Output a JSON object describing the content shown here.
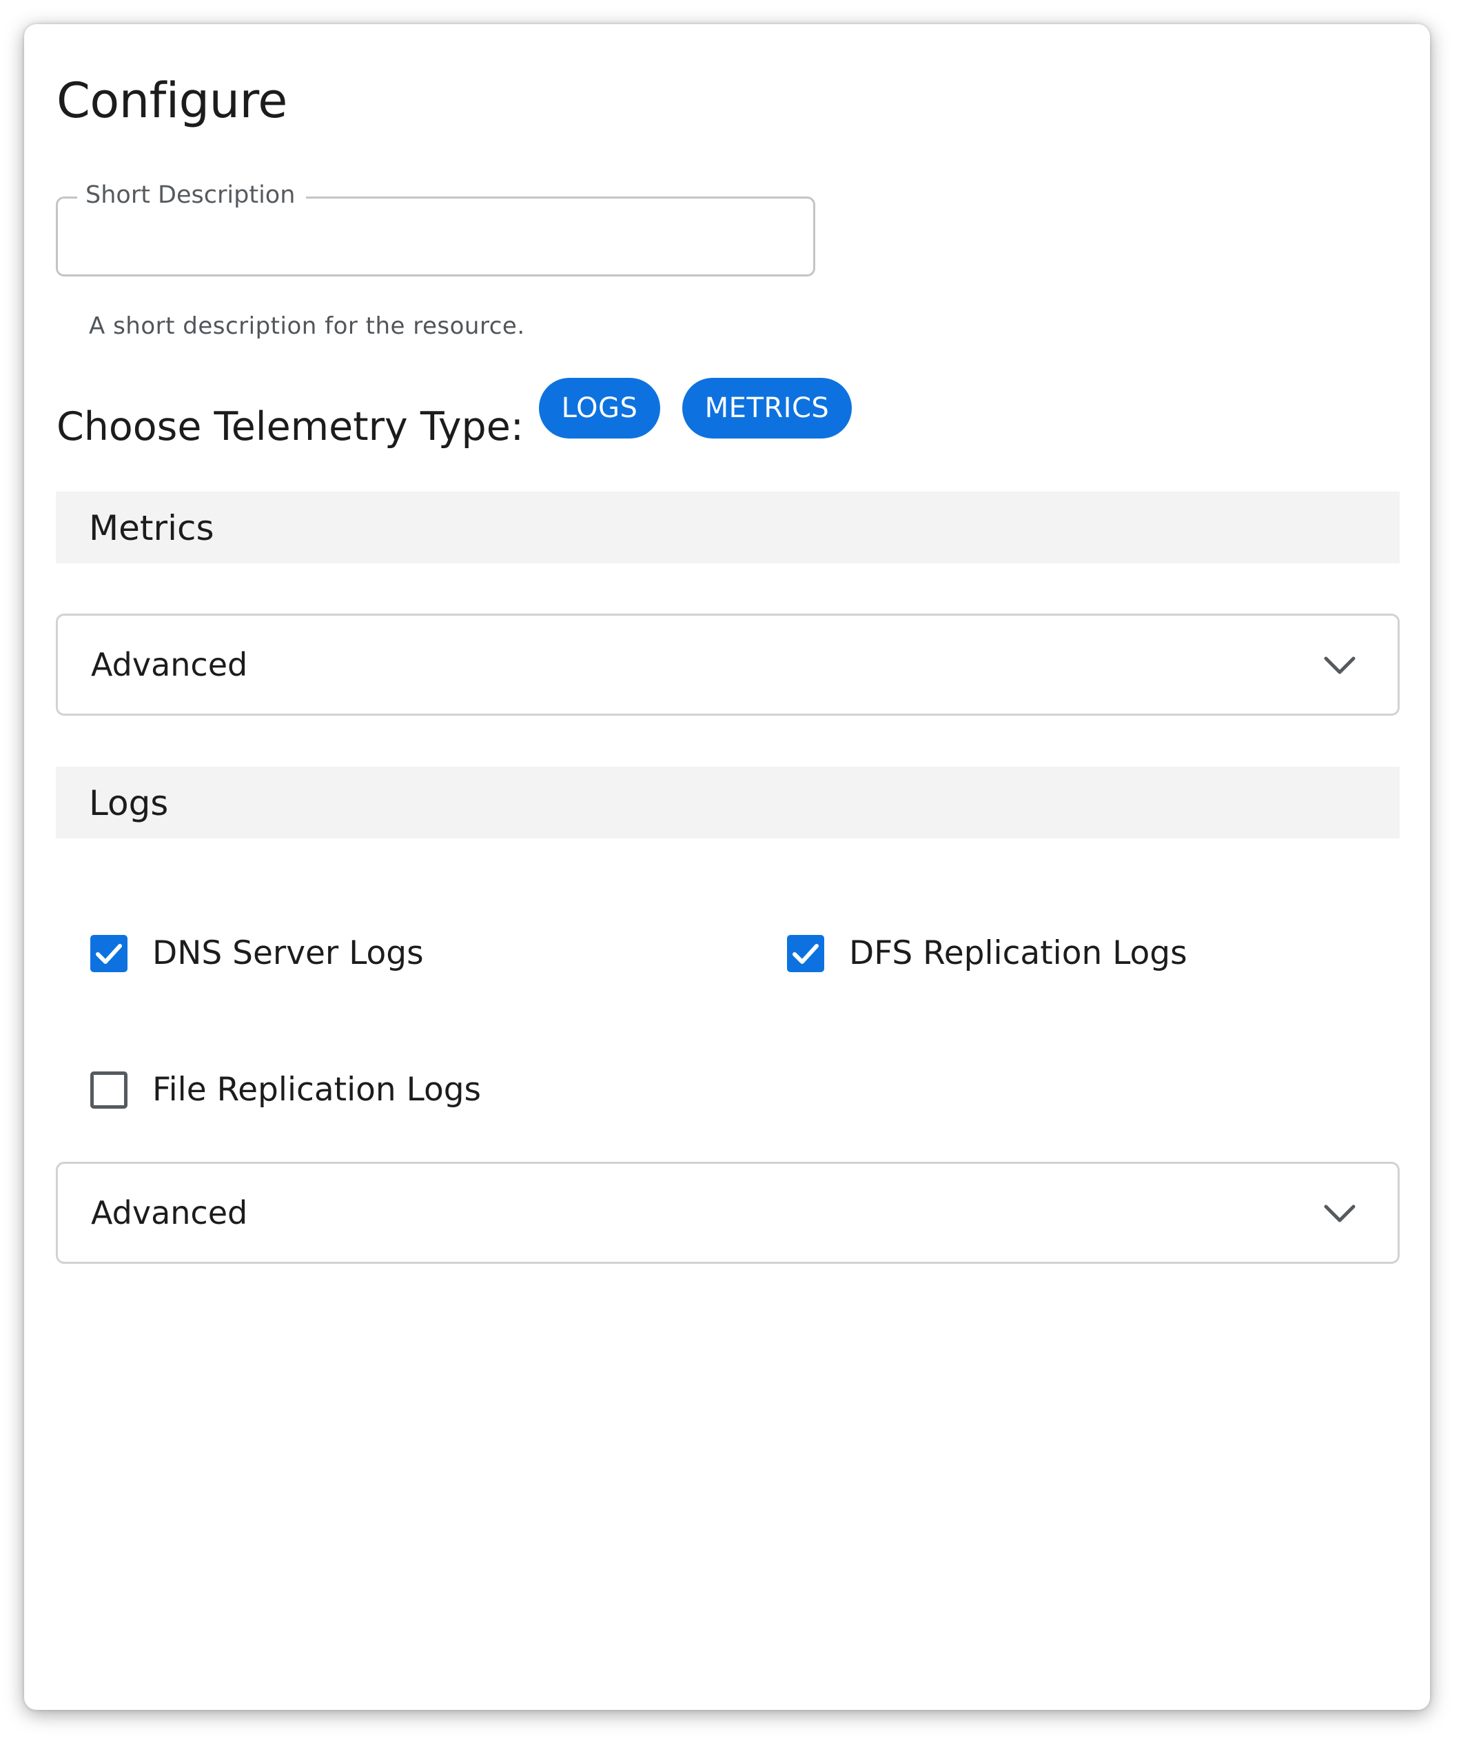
{
  "page": {
    "title": "Configure"
  },
  "short_description": {
    "label": "Short Description",
    "value": "",
    "placeholder": "",
    "helper": "A short description for the resource."
  },
  "telemetry": {
    "label": "Choose Telemetry Type:",
    "chips": [
      {
        "label": "LOGS",
        "selected": true
      },
      {
        "label": "METRICS",
        "selected": true
      }
    ]
  },
  "metrics_section": {
    "title": "Metrics",
    "advanced_label": "Advanced",
    "advanced_icon": "chevron-down-icon"
  },
  "logs_section": {
    "title": "Logs",
    "options": [
      {
        "label": "DNS Server Logs",
        "checked": true
      },
      {
        "label": "DFS Replication Logs",
        "checked": true
      },
      {
        "label": "File Replication Logs",
        "checked": false
      }
    ],
    "advanced_label": "Advanced",
    "advanced_icon": "chevron-down-icon"
  },
  "colors": {
    "accent": "#0d72e0",
    "section_bg": "#f3f3f3",
    "border": "#d2d2d2",
    "text": "#1c1c1c",
    "muted": "#555a5e"
  }
}
